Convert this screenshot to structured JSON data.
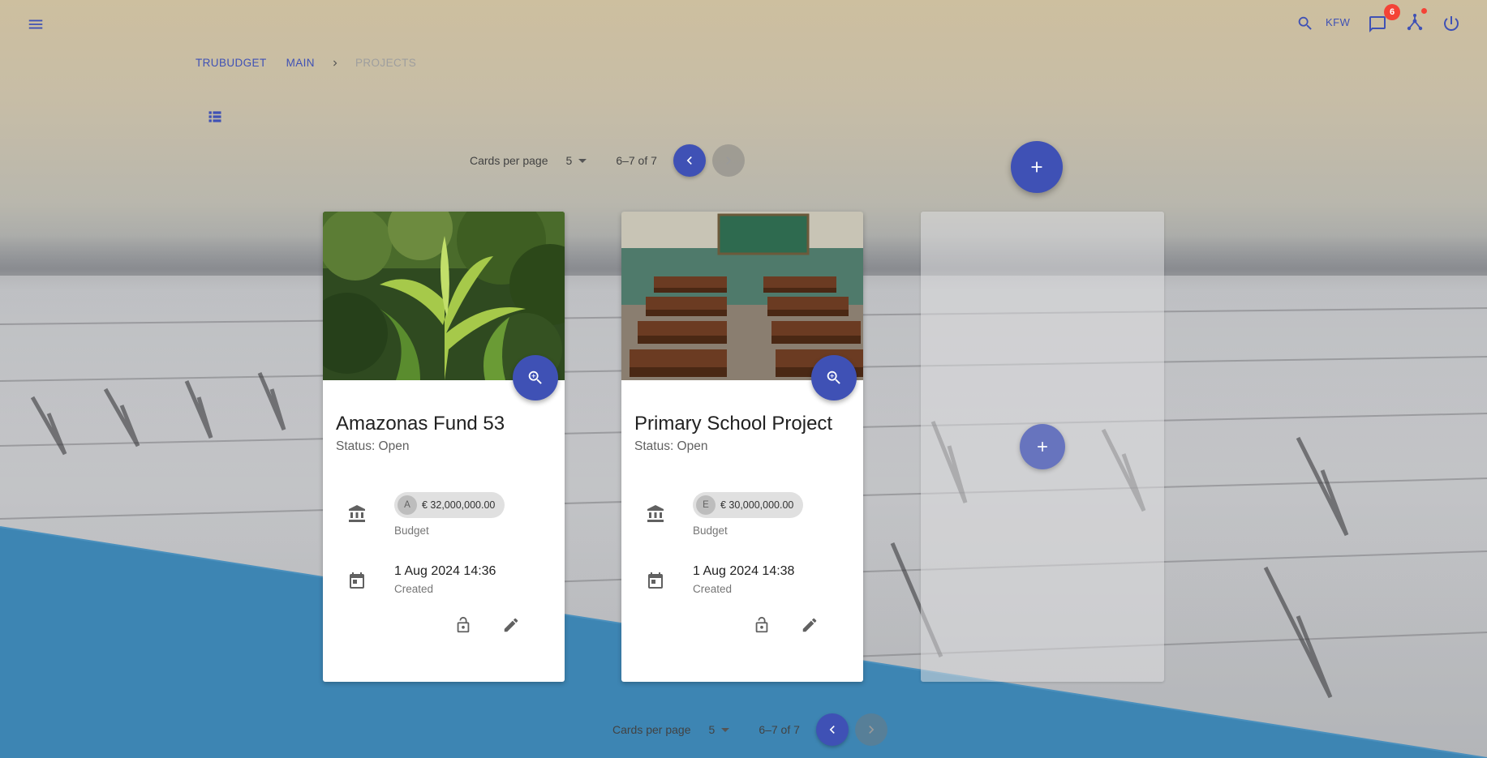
{
  "topbar": {
    "user": "KFW",
    "notification_count": "6"
  },
  "breadcrumb": {
    "items": [
      "TRUBUDGET",
      "MAIN",
      "PROJECTS"
    ]
  },
  "pagination": {
    "label": "Cards per page",
    "per_page": "5",
    "range": "6–7 of 7"
  },
  "cards": [
    {
      "title": "Amazonas Fund 53",
      "status": "Status: Open",
      "budget_avatar": "A",
      "budget": "€ 32,000,000.00",
      "budget_label": "Budget",
      "created_date": "1 Aug 2024 14:36",
      "created_label": "Created",
      "image": "rainforest-photo"
    },
    {
      "title": "Primary School Project",
      "status": "Status: Open",
      "budget_avatar": "E",
      "budget": "€ 30,000,000.00",
      "budget_label": "Budget",
      "created_date": "1 Aug 2024 14:38",
      "created_label": "Created",
      "image": "classroom-photo"
    }
  ],
  "colors": {
    "primary": "#3f51b5",
    "badge": "#f44336",
    "wave": "#3d85b3"
  }
}
